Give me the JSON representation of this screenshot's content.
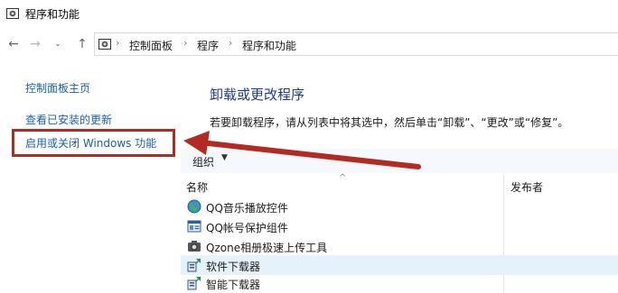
{
  "window": {
    "title": "程序和功能"
  },
  "address": {
    "crumbs": [
      "控制面板",
      "程序",
      "程序和功能"
    ],
    "separator": "›"
  },
  "nav": {
    "back": "←",
    "forward": "→",
    "recent": "⌄",
    "up": "↑"
  },
  "left_pane": {
    "home": "控制面板主页",
    "updates": "查看已安装的更新",
    "features": "启用或关闭 Windows 功能"
  },
  "main": {
    "title": "卸载或更改程序",
    "description": "若要卸载程序，请从列表中将其选中，然后单击“卸载”、“更改”或“修复”。"
  },
  "toolbar": {
    "organize": "组织",
    "organize_caret": "▼"
  },
  "table": {
    "columns": [
      "名称",
      "发布者"
    ],
    "sort_indicator": "^",
    "rows": [
      {
        "name": "QQ音乐播放控件",
        "icon": "globe-icon"
      },
      {
        "name": "QQ帐号保护组件",
        "icon": "id-card-icon"
      },
      {
        "name": "Qzone相册极速上传工具",
        "icon": "camera-icon"
      },
      {
        "name": "软件下载器",
        "icon": "installer-icon"
      },
      {
        "name": "智能下载器",
        "icon": "installer-icon"
      }
    ]
  },
  "colors": {
    "annotation_red": "#b32a22",
    "link_blue": "#1a5fb4",
    "title_blue": "#1e3a8a",
    "selected_row": "#e5f1fb"
  }
}
